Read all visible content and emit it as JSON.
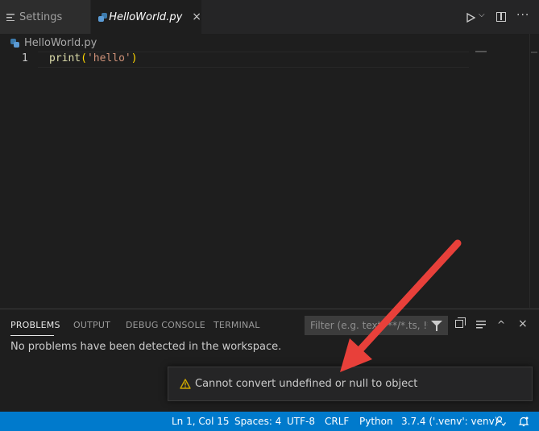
{
  "tabs": [
    {
      "label": "Settings",
      "icon": "menu-lines-icon",
      "active": false
    },
    {
      "label": "HelloWorld.py",
      "icon": "python-file-icon",
      "active": true,
      "close": "×"
    }
  ],
  "editor_actions": {
    "run": "run-icon",
    "dropdown": "⌵",
    "split": "split-editor-icon",
    "more": "···"
  },
  "breadcrumb": {
    "file": "HelloWorld.py"
  },
  "code": {
    "line_number": "1",
    "tokens": {
      "fn": "print",
      "open": "(",
      "str": "'hello'",
      "close": ")"
    }
  },
  "panel": {
    "tabs": {
      "problems": "PROBLEMS",
      "output": "OUTPUT",
      "debug": "DEBUG CONSOLE",
      "terminal": "TERMINAL"
    },
    "filter_placeholder": "Filter (e.g. text, **/*.ts, !**/...",
    "maximize": "^",
    "close": "×",
    "message": "No problems have been detected in the workspace."
  },
  "notification": {
    "text": "Cannot convert undefined or null to object",
    "level": "warning",
    "icon": "warning-icon"
  },
  "statusbar": {
    "cursor": "Ln 1, Col 15",
    "spaces": "Spaces: 4",
    "encoding": "UTF-8",
    "eol": "CRLF",
    "language": "Python",
    "interpreter": "3.7.4 ('.venv': venv)"
  },
  "colors": {
    "statusbar": "#007acc",
    "editor_bg": "#1e1e1e",
    "warning": "#cca700",
    "arrow": "#e8403a"
  }
}
